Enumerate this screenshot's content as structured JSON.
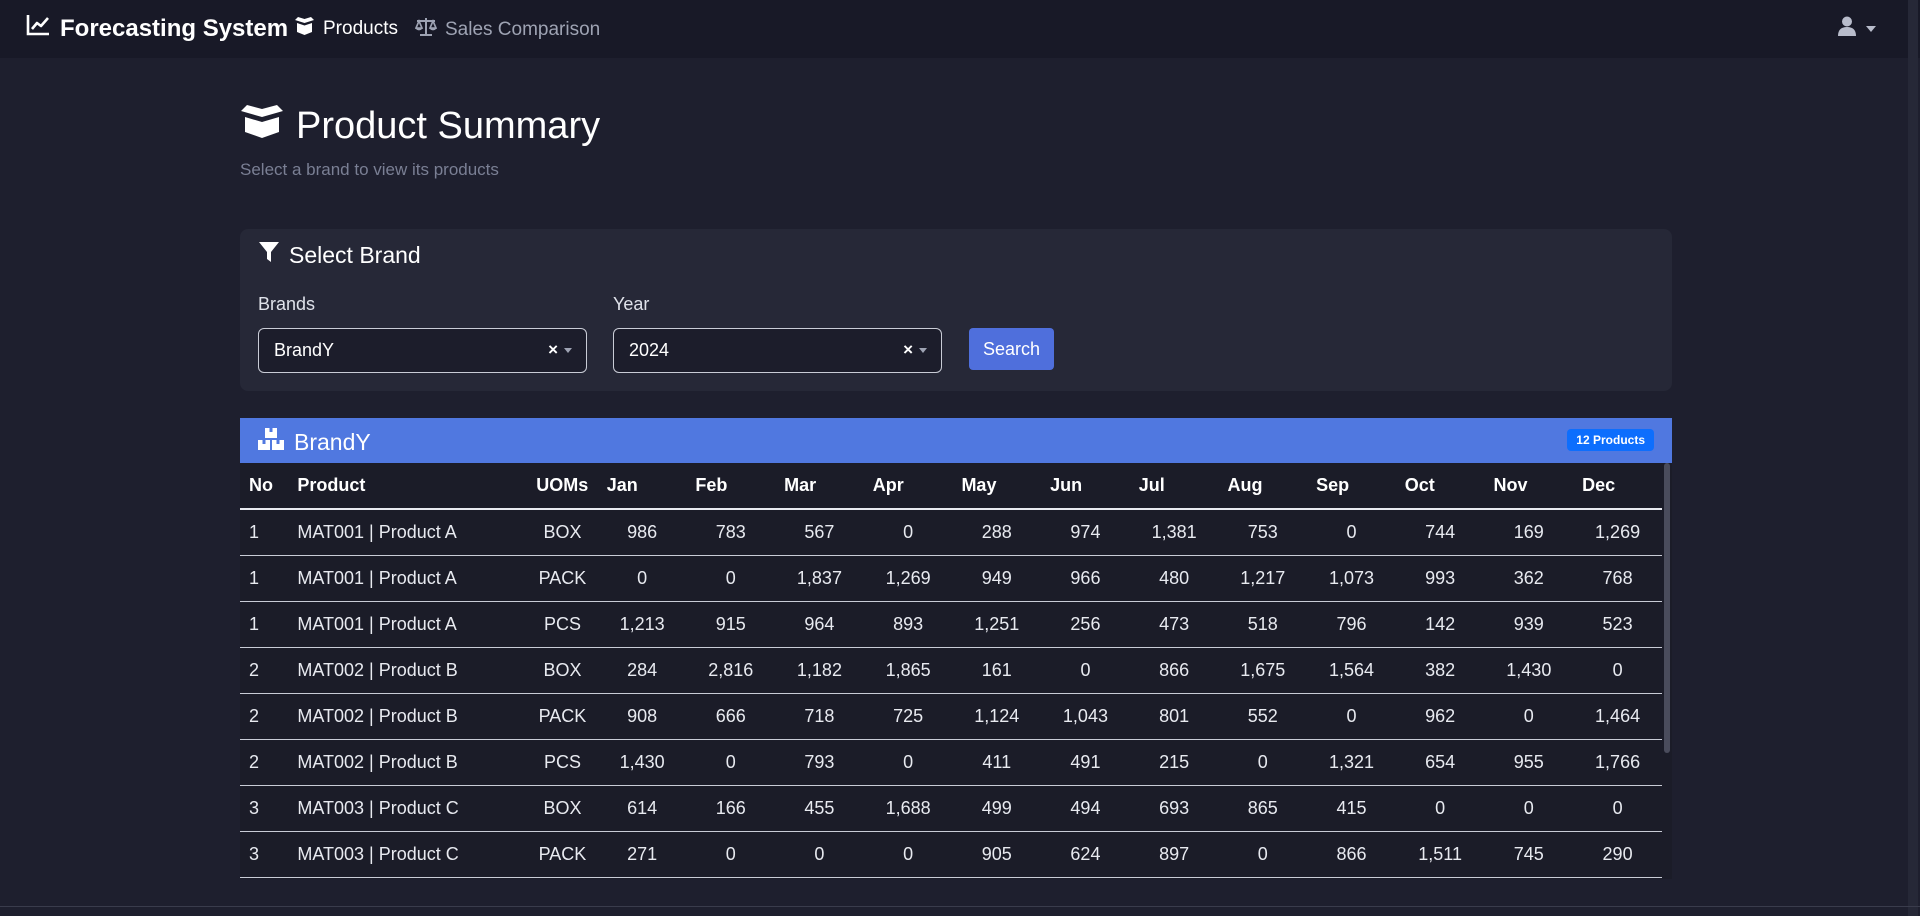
{
  "navbar": {
    "brand": "Forecasting System",
    "links": [
      {
        "label": "Products",
        "icon": "box-open-icon",
        "active": true
      },
      {
        "label": "Sales Comparison",
        "icon": "balance-scale-icon",
        "active": false
      }
    ],
    "user_icon": "user-icon"
  },
  "page": {
    "title": "Product Summary",
    "subtitle": "Select a brand to view its products"
  },
  "filter": {
    "title": "Select Brand",
    "brands_label": "Brands",
    "brands_value": "BrandY",
    "year_label": "Year",
    "year_value": "2024",
    "clear_glyph": "×",
    "search_label": "Search"
  },
  "result": {
    "title": "BrandY",
    "count_badge": "12 Products",
    "columns": [
      "No",
      "Product",
      "UOMs",
      "Jan",
      "Feb",
      "Mar",
      "Apr",
      "May",
      "Jun",
      "Jul",
      "Aug",
      "Sep",
      "Oct",
      "Nov",
      "Dec"
    ],
    "rows": [
      [
        "1",
        "MAT001 | Product A",
        "BOX",
        "986",
        "783",
        "567",
        "0",
        "288",
        "974",
        "1,381",
        "753",
        "0",
        "744",
        "169",
        "1,269"
      ],
      [
        "1",
        "MAT001 | Product A",
        "PACK",
        "0",
        "0",
        "1,837",
        "1,269",
        "949",
        "966",
        "480",
        "1,217",
        "1,073",
        "993",
        "362",
        "768"
      ],
      [
        "1",
        "MAT001 | Product A",
        "PCS",
        "1,213",
        "915",
        "964",
        "893",
        "1,251",
        "256",
        "473",
        "518",
        "796",
        "142",
        "939",
        "523"
      ],
      [
        "2",
        "MAT002 | Product B",
        "BOX",
        "284",
        "2,816",
        "1,182",
        "1,865",
        "161",
        "0",
        "866",
        "1,675",
        "1,564",
        "382",
        "1,430",
        "0"
      ],
      [
        "2",
        "MAT002 | Product B",
        "PACK",
        "908",
        "666",
        "718",
        "725",
        "1,124",
        "1,043",
        "801",
        "552",
        "0",
        "962",
        "0",
        "1,464"
      ],
      [
        "2",
        "MAT002 | Product B",
        "PCS",
        "1,430",
        "0",
        "793",
        "0",
        "411",
        "491",
        "215",
        "0",
        "1,321",
        "654",
        "955",
        "1,766"
      ],
      [
        "3",
        "MAT003 | Product C",
        "BOX",
        "614",
        "166",
        "455",
        "1,688",
        "499",
        "494",
        "693",
        "865",
        "415",
        "0",
        "0",
        "0"
      ],
      [
        "3",
        "MAT003 | Product C",
        "PACK",
        "271",
        "0",
        "0",
        "0",
        "905",
        "624",
        "897",
        "0",
        "866",
        "1,511",
        "745",
        "290"
      ]
    ]
  },
  "colors": {
    "background": "#1e1f2e",
    "navbar": "#181927",
    "card": "#262837",
    "accent": "#5078e0",
    "button": "#4f6fdc",
    "badge": "#0d6efd"
  }
}
